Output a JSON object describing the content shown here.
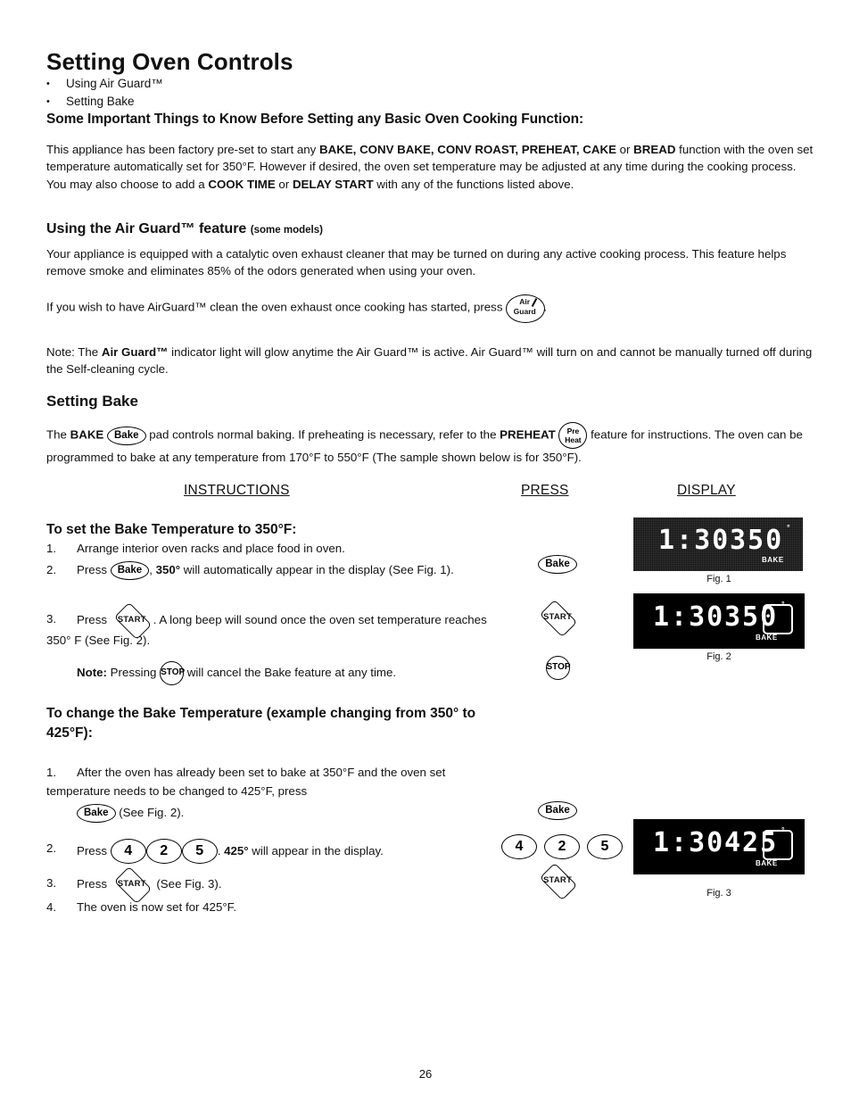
{
  "page": {
    "title": "Setting Oven Controls",
    "number": "26"
  },
  "bullets": [
    {
      "marker": "•",
      "text": "Using Air Guard™"
    },
    {
      "marker": "•",
      "text": "Setting Bake"
    }
  ],
  "headings": {
    "important": "Some Important Things to Know Before Setting any Basic Oven Cooking Function:",
    "air_guard": "Using the Air Guard™ feature",
    "air_guard_small": "(some models)",
    "setting_bake": "Setting Bake",
    "set_350": "To set the Bake Temperature to 350°F:",
    "change_425": "To change the Bake Temperature (example changing from 350° to 425°F):"
  },
  "columns": {
    "instructions": "INSTRUCTIONS",
    "press": "PRESS",
    "display": "DISPLAY"
  },
  "paragraphs": {
    "intro_1": "This appliance has been factory pre-set to start any ",
    "intro_bold_1": "BAKE, CONV BAKE, CONV ROAST, PREHEAT, CAKE",
    "intro_2": " or ",
    "intro_bold_2": "BREAD",
    "intro_3": " function with the oven set temperature automatically set for 350°F. However if desired, the oven set temperature may be adjusted at any time during the cooking process. You may also choose to add a ",
    "intro_bold_3": "COOK TIME",
    "intro_4": " or ",
    "intro_bold_4": "DELAY START",
    "intro_5": " with any of the functions listed above.",
    "air_guard_body": "Your appliance is equipped with a catalytic oven exhaust cleaner that may be turned on during any active cooking process. This feature helps remove smoke and eliminates 85% of the odors generated when using your oven.",
    "air_guard_press_1": "If you wish to have AirGuard™ clean the oven exhaust once cooking has started, press",
    "air_guard_press_2": ".",
    "note_1": "Note: The ",
    "note_bold": "Air Guard™",
    "note_2": " indicator light will glow anytime the Air Guard™ is active. Air Guard™ will turn on and cannot be manually turned off during the Self-cleaning cycle.",
    "bake_1": "The ",
    "bake_bold_1": "BAKE",
    "bake_2": " pad controls normal baking. If preheating is necessary, refer to the ",
    "bake_bold_2": "PREHEAT",
    "bake_3": " feature for instructions. The oven can be programmed to bake at any temperature from 170°F to 550°F (The sample shown below is for 350°F)."
  },
  "steps_350": [
    {
      "num": "1.",
      "text_1": "Arrange interior oven racks and place food in oven.",
      "text_2": "",
      "text_3": ""
    },
    {
      "num": "2.",
      "text_1": "Press ",
      "bold": "350°",
      "text_2": ", ",
      "text_3": " will automatically appear in the display (See Fig. 1)."
    },
    {
      "num": "3.",
      "text_1": "Press ",
      "text_2": ". A long beep will sound once the oven set temperature reaches 350° F (See Fig. 2)."
    }
  ],
  "note_step": {
    "bold": "Note:",
    "text_1": " Pressing ",
    "text_2": " will cancel the Bake feature at any time."
  },
  "steps_425": [
    {
      "num": "1.",
      "text_1": "After the oven has already been set to bake at 350°F and the oven set temperature needs to be changed to 425°F, press",
      "text_2": "(See Fig. 2)."
    },
    {
      "num": "2.",
      "text_1": "Press ",
      "bold": "425°",
      "text_2": ". ",
      "text_3": " will appear in the display."
    },
    {
      "num": "3.",
      "text_1": "Press ",
      "text_2": " (See Fig. 3)."
    },
    {
      "num": "4.",
      "text_1": "The oven is now set for 425°F.",
      "text_2": ""
    }
  ],
  "keys": {
    "bake": "Bake",
    "start": "START",
    "stop": "STOP",
    "preheat_line1": "Pre",
    "preheat_line2": "Heat",
    "air_line1": "Air",
    "air_line2": "Guard",
    "num_4": "4",
    "num_2": "2",
    "num_5": "5"
  },
  "figures": [
    {
      "id": "fig1",
      "label": "Fig. 1",
      "time": "1:30",
      "temp": "350",
      "degree": "°",
      "mode": "BAKE",
      "indicator_box": false
    },
    {
      "id": "fig2",
      "label": "Fig. 2",
      "time": "1:30",
      "temp": "350",
      "degree": "°",
      "mode": "BAKE",
      "indicator_box": true
    },
    {
      "id": "fig3",
      "label": "Fig. 3",
      "time": "1:30",
      "temp": "425",
      "degree": "°",
      "mode": "BAKE",
      "indicator_box": true
    }
  ],
  "colors": {
    "text": "#111111",
    "panel_bg": "#000000",
    "led": "#ffffff"
  }
}
